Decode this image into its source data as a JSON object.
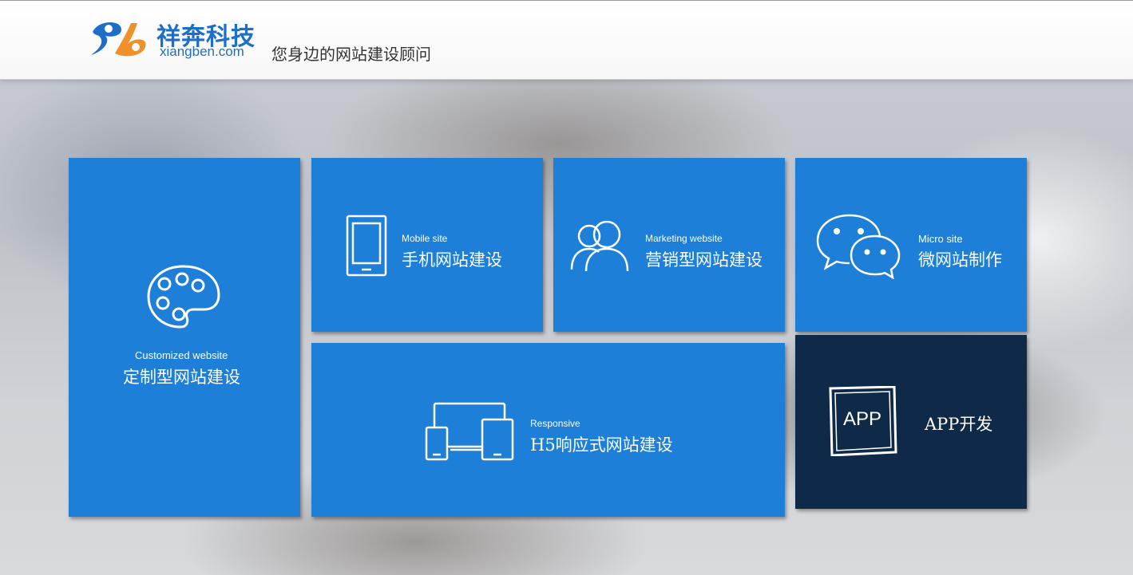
{
  "header": {
    "brand_cn": "祥奔科技",
    "brand_en": "xiangben.com",
    "slogan": "您身边的网站建设顾问"
  },
  "tiles": {
    "customized": {
      "en": "Customized website",
      "cn": "定制型网站建设",
      "icon": "palette-icon"
    },
    "mobile": {
      "en": "Mobile site",
      "cn": "手机网站建设",
      "icon": "phone-icon"
    },
    "marketing": {
      "en": "Marketing website",
      "cn": "营销型网站建设",
      "icon": "users-icon"
    },
    "micro": {
      "en": "Micro site",
      "cn": "微网站制作",
      "icon": "wechat-icon"
    },
    "responsive": {
      "en": "Responsive",
      "cn": "H5响应式网站建设",
      "icon": "devices-icon"
    },
    "app": {
      "badge": "APP",
      "cn": "APP开发",
      "icon": "app-badge-icon"
    }
  },
  "colors": {
    "tile_blue": "#1e7fd8",
    "tile_dark": "#0e2a48",
    "brand_blue": "#1c6ec8",
    "brand_orange": "#f0902a"
  }
}
